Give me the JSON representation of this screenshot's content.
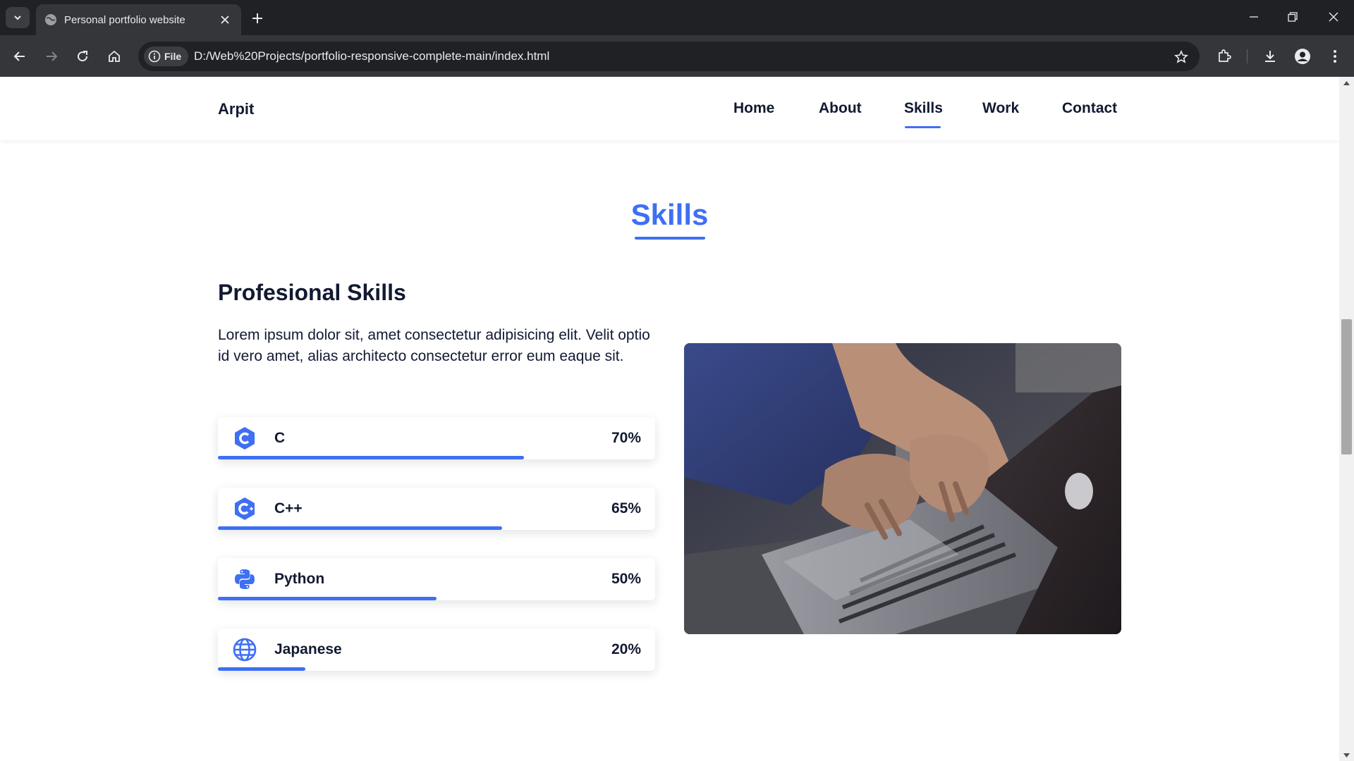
{
  "browser": {
    "tab_title": "Personal portfolio website",
    "chip_label": "File",
    "url": "D:/Web%20Projects/portfolio-responsive-complete-main/index.html"
  },
  "site": {
    "logo": "Arpit",
    "nav": [
      {
        "label": "Home"
      },
      {
        "label": "About"
      },
      {
        "label": "Skills",
        "active": true
      },
      {
        "label": "Work"
      },
      {
        "label": "Contact"
      }
    ]
  },
  "skills_section": {
    "title": "Skills",
    "subtitle": "Profesional Skills",
    "description": "Lorem ipsum dolor sit, amet consectetur adipisicing elit. Velit optio id vero amet, alias architecto consectetur error eum eaque sit.",
    "items": [
      {
        "name": "C",
        "percent_label": "70%",
        "level": 0.7,
        "icon": "c-language-icon"
      },
      {
        "name": "C++",
        "percent_label": "65%",
        "level": 0.65,
        "icon": "cpp-language-icon"
      },
      {
        "name": "Python",
        "percent_label": "50%",
        "level": 0.5,
        "icon": "python-icon"
      },
      {
        "name": "Japanese",
        "percent_label": "20%",
        "level": 0.2,
        "icon": "globe-icon"
      }
    ],
    "image": "photo of hands typing on a laptop"
  },
  "colors": {
    "accent": "#3e6ff4",
    "text": "#121a32",
    "chrome_dark": "#202124",
    "chrome_toolbar": "#35363a"
  }
}
